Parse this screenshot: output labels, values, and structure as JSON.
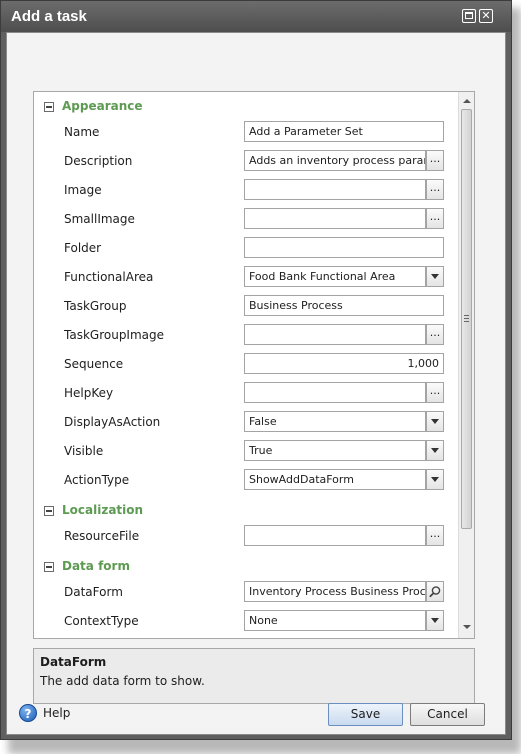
{
  "window": {
    "title": "Add a task"
  },
  "sections": {
    "appearance": "Appearance",
    "localization": "Localization",
    "data_form": "Data form"
  },
  "properties": {
    "name": {
      "label": "Name",
      "value": "Add a Parameter Set"
    },
    "description": {
      "label": "Description",
      "value": "Adds an inventory process parameter set"
    },
    "image": {
      "label": "Image",
      "value": ""
    },
    "small_image": {
      "label": "SmallImage",
      "value": ""
    },
    "folder": {
      "label": "Folder",
      "value": ""
    },
    "functional_area": {
      "label": "FunctionalArea",
      "value": "Food Bank Functional Area"
    },
    "task_group": {
      "label": "TaskGroup",
      "value": "Business Process"
    },
    "task_group_image": {
      "label": "TaskGroupImage",
      "value": ""
    },
    "sequence": {
      "label": "Sequence",
      "value": "1,000"
    },
    "help_key": {
      "label": "HelpKey",
      "value": ""
    },
    "display_as_action": {
      "label": "DisplayAsAction",
      "value": "False"
    },
    "visible": {
      "label": "Visible",
      "value": "True"
    },
    "action_type": {
      "label": "ActionType",
      "value": "ShowAddDataForm"
    },
    "resource_file": {
      "label": "ResourceFile",
      "value": ""
    },
    "data_form": {
      "label": "DataForm",
      "value": "Inventory Process Business Process"
    },
    "context_type": {
      "label": "ContextType",
      "value": "None"
    }
  },
  "browse_glyph": "...",
  "description_panel": {
    "title": "DataForm",
    "text": "The add data form to show."
  },
  "footer": {
    "help_label": "Help",
    "help_glyph": "?",
    "save_label": "Save",
    "cancel_label": "Cancel"
  },
  "icons": {
    "close": "close-icon",
    "maximize": "maximize-icon",
    "help": "help-icon",
    "search": "search-icon",
    "dropdown": "chevron-down-icon",
    "collapse": "collapse-icon"
  }
}
